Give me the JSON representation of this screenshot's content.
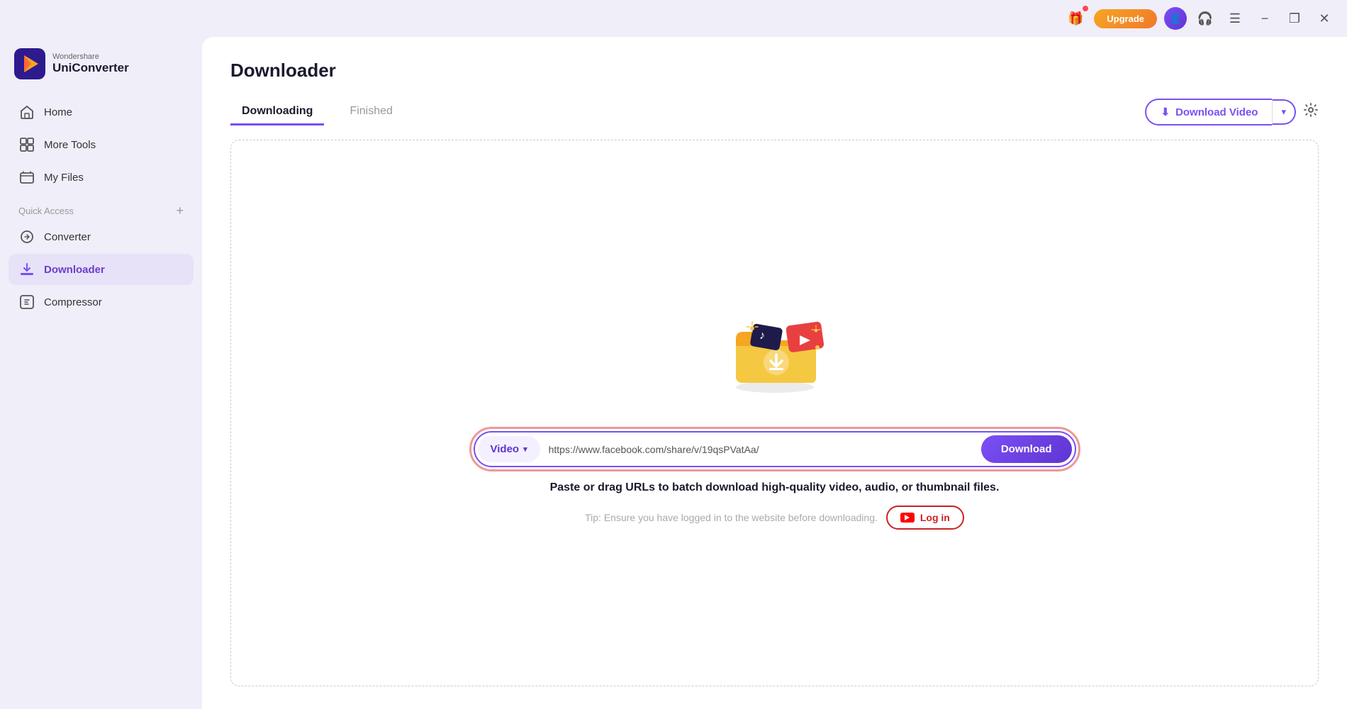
{
  "app": {
    "brand": "Wondershare",
    "name": "UniConverter"
  },
  "titlebar": {
    "upgrade_label": "Upgrade",
    "minimize_label": "−",
    "restore_label": "❐",
    "close_label": "✕"
  },
  "sidebar": {
    "nav_items": [
      {
        "id": "home",
        "label": "Home",
        "icon": "🏠",
        "active": false
      },
      {
        "id": "more-tools",
        "label": "More Tools",
        "icon": "📦",
        "active": false
      },
      {
        "id": "my-files",
        "label": "My Files",
        "icon": "📋",
        "active": false
      }
    ],
    "quick_access_label": "Quick Access",
    "quick_access_items": [
      {
        "id": "converter",
        "label": "Converter",
        "icon": "🔄",
        "active": false
      },
      {
        "id": "downloader",
        "label": "Downloader",
        "icon": "📥",
        "active": true
      },
      {
        "id": "compressor",
        "label": "Compressor",
        "icon": "🗜",
        "active": false
      }
    ]
  },
  "main": {
    "page_title": "Downloader",
    "tabs": [
      {
        "id": "downloading",
        "label": "Downloading",
        "active": true
      },
      {
        "id": "finished",
        "label": "Finished",
        "active": false
      }
    ],
    "download_video_btn": "Download Video",
    "content": {
      "url_input_placeholder": "https://www.facebook.com/share/v/19qsPVatAa/",
      "video_type_label": "Video",
      "download_btn_label": "Download",
      "paste_text": "Paste or drag URLs to batch download high-quality video, audio, or thumbnail files.",
      "tip_text": "Tip: Ensure you have logged in to the website before downloading.",
      "login_btn_label": "Log in"
    }
  }
}
